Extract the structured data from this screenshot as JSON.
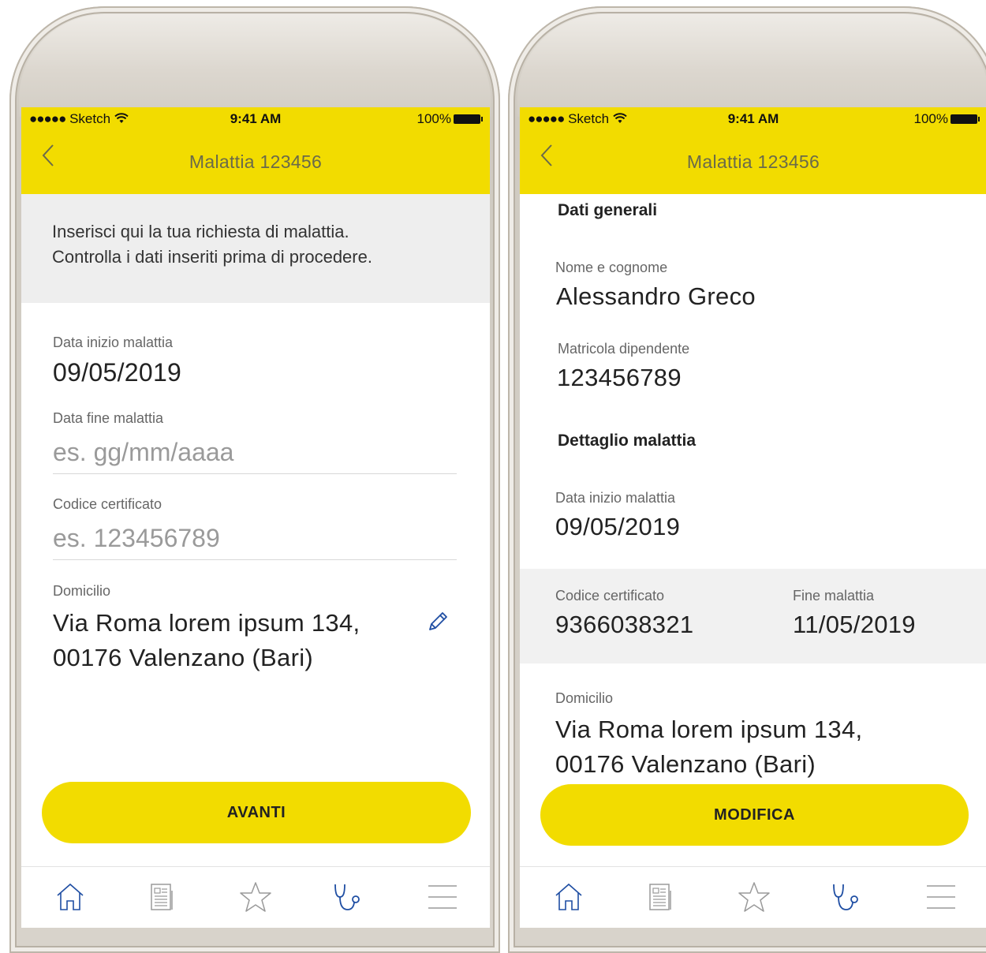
{
  "status": {
    "carrier_dots": "●●●●●",
    "carrier": "Sketch",
    "time": "9:41 AM",
    "battery": "100%"
  },
  "left_screen": {
    "nav_title": "Malattia 123456",
    "intro_line1": "Inserisci qui la tua richiesta di malattia.",
    "intro_line2": "Controlla i dati inseriti prima di procedere.",
    "start_label": "Data inizio malattia",
    "start_value": "09/05/2019",
    "end_label": "Data fine malattia",
    "end_placeholder": "es. gg/mm/aaaa",
    "cert_label": "Codice certificato",
    "cert_placeholder": "es. 123456789",
    "home_label": "Domicilio",
    "home_line1": "Via Roma lorem ipsum 134,",
    "home_line2": "00176 Valenzano (Bari)",
    "cta_label": "AVANTI"
  },
  "right_screen": {
    "nav_title": "Malattia 123456",
    "general_title": "Dati generali",
    "name_label": "Nome e cognome",
    "name_value": "Alessandro Greco",
    "id_label": "Matricola dipendente",
    "id_value": "123456789",
    "detail_title": "Dettaglio malattia",
    "start_label": "Data inizio malattia",
    "start_value": "09/05/2019",
    "cert_label": "Codice certificato",
    "cert_value": "9366038321",
    "end_label": "Fine malattia",
    "end_value": "11/05/2019",
    "home_label": "Domicilio",
    "home_line1": "Via Roma lorem ipsum 134,",
    "home_line2": "00176 Valenzano (Bari)",
    "cta_label": "MODIFICA"
  },
  "tabbar": {
    "icons": [
      "home-icon",
      "news-icon",
      "star-icon",
      "stethoscope-icon",
      "menu-icon"
    ],
    "active": "stethoscope-icon",
    "active_color": "#1f4ea3",
    "inactive_color": "#9a9a9a"
  },
  "colors": {
    "brand_yellow": "#f2dc00",
    "icon_blue": "#1f4ea3"
  }
}
